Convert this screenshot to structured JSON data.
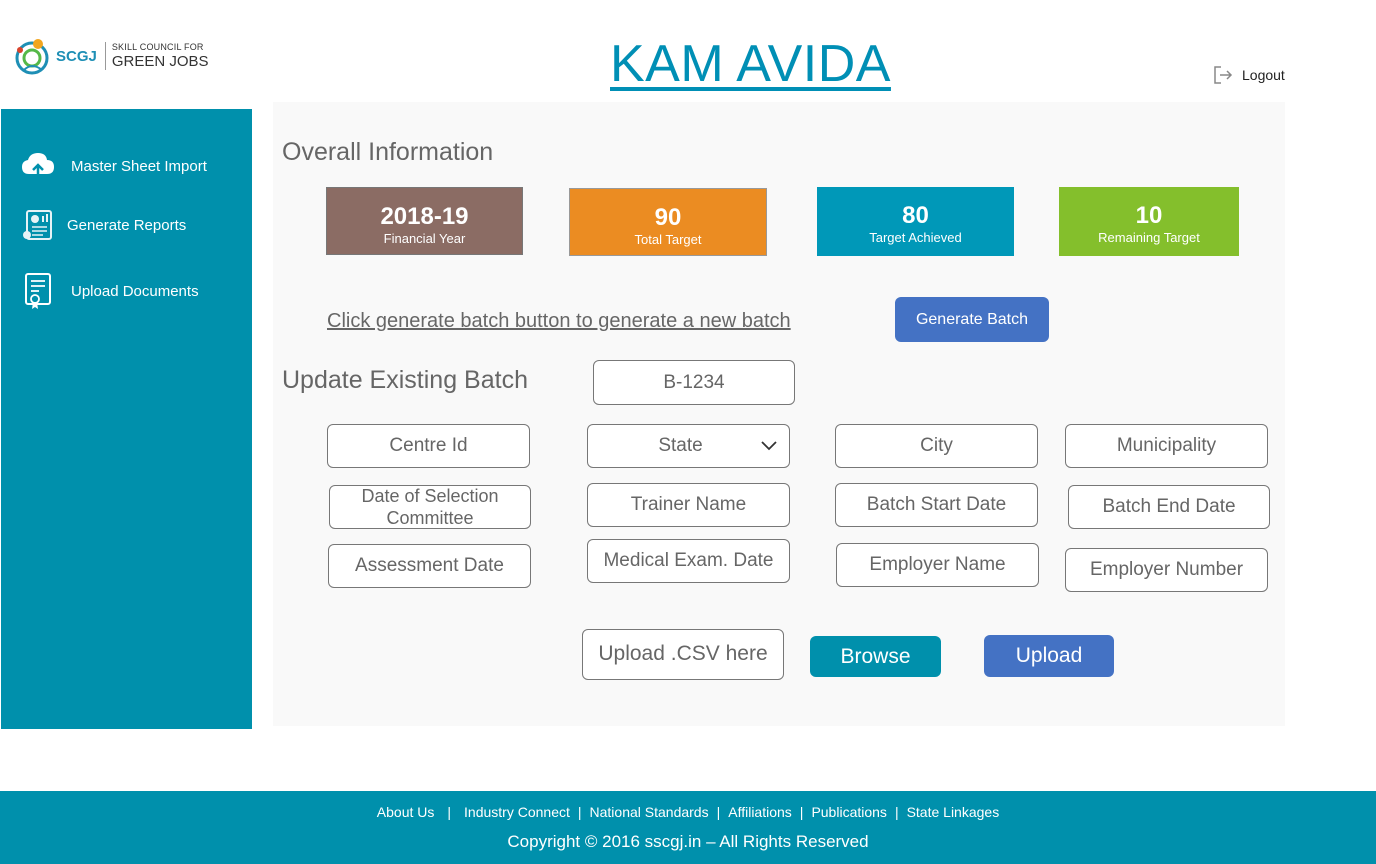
{
  "logo": {
    "abbr": "SCGJ",
    "line1": "SKILL COUNCIL FOR",
    "line2": "GREEN JOBS"
  },
  "app_title": "KAM AVIDA",
  "logout_label": "Logout",
  "sidebar": {
    "items": [
      {
        "label": "Master Sheet Import",
        "icon": "cloud-upload-icon"
      },
      {
        "label": "Generate Reports",
        "icon": "report-icon"
      },
      {
        "label": "Upload Documents",
        "icon": "document-certificate-icon"
      }
    ]
  },
  "overall": {
    "heading": "Overall Information",
    "stats": [
      {
        "value": "2018-19",
        "label": "Financial Year",
        "color": "#8b6c64"
      },
      {
        "value": "90",
        "label": "Total Target",
        "color": "#eb8c22"
      },
      {
        "value": "80",
        "label": "Target Achieved",
        "color": "#0098b8"
      },
      {
        "value": "10",
        "label": "Remaining Target",
        "color": "#84bf2c"
      }
    ]
  },
  "generate": {
    "link_text": "Click generate batch button to generate a new batch",
    "button_label": "Generate Batch"
  },
  "update": {
    "heading": "Update Existing Batch",
    "batch_id_value": "B-1234",
    "fields": {
      "centre_id": "Centre Id",
      "state": "State",
      "city": "City",
      "municipality": "Municipality",
      "date_of_selection_committee": "Date of Selection Committee",
      "trainer_name": "Trainer Name",
      "batch_start_date": "Batch Start Date",
      "batch_end_date": "Batch End Date",
      "assessment_date": "Assessment Date",
      "medical_exam_date": "Medical Exam. Date",
      "employer_name": "Employer Name",
      "employer_number": "Employer Number"
    }
  },
  "upload": {
    "placeholder": "Upload .CSV here",
    "browse_label": "Browse",
    "upload_label": "Upload"
  },
  "footer": {
    "links": [
      "About Us",
      "Industry Connect",
      "National Standards",
      "Affiliations",
      "Publications",
      "State Linkages"
    ],
    "separator": "|",
    "copyright": "Copyright © 2016 sscgj.in – All Rights Reserved"
  }
}
